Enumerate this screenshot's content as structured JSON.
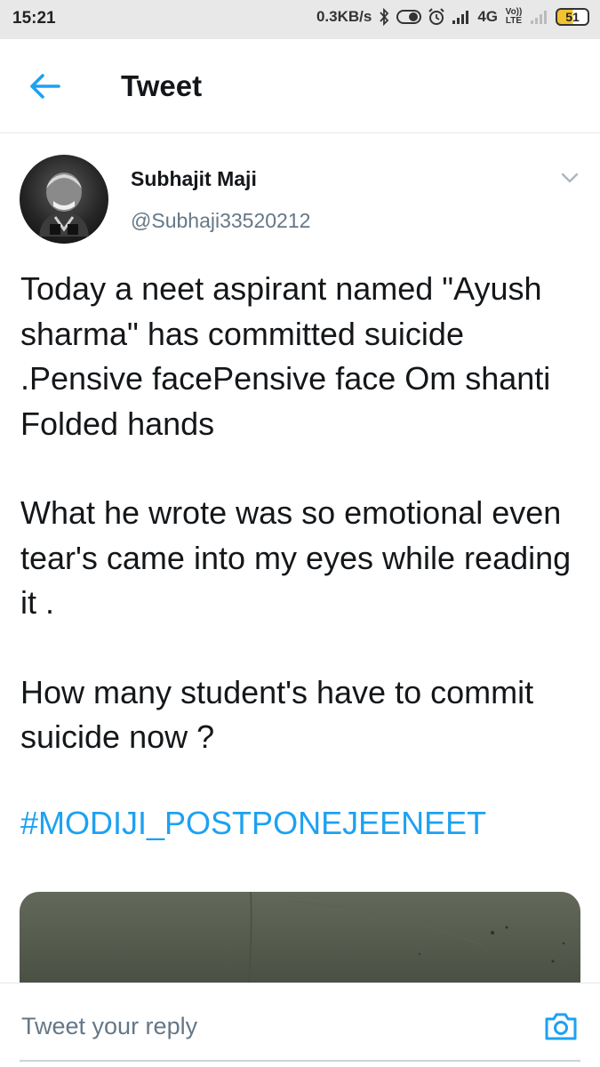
{
  "status_bar": {
    "time": "15:21",
    "network_speed": "0.3KB/s",
    "network_type": "4G",
    "volte_label": "Vo)) LTE",
    "battery_level": "51"
  },
  "app_bar": {
    "title": "Tweet",
    "back_icon": "arrow-left-icon"
  },
  "tweet": {
    "author_name": "Subhajit Maji",
    "author_handle": "@Subhaji33520212",
    "paragraphs": [
      "Today a neet aspirant named \"Ayush sharma\" has committed suicide .Pensive facePensive face Om shanti Folded hands",
      "What he wrote was so emotional even tear's came into my eyes while reading it .",
      "How many student's have to commit suicide now ?"
    ],
    "hashtag": "#MODIJI_POSTPONEJEENEET"
  },
  "reply": {
    "placeholder": "Tweet your reply",
    "camera_icon": "camera-icon"
  },
  "colors": {
    "accent": "#1da1f2",
    "secondary_text": "#657786",
    "primary_text": "#14171a",
    "status_bar_bg": "#e8e8e8"
  }
}
